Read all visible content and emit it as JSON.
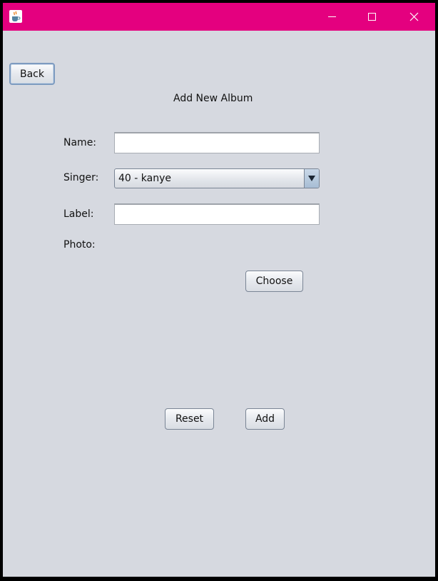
{
  "window": {
    "title": "",
    "titlebar_color": "#e4007f",
    "icons": {
      "app": "java-cup-icon",
      "minimize": "minimize-icon",
      "maximize": "maximize-icon",
      "close": "close-icon"
    }
  },
  "nav": {
    "back_label": "Back"
  },
  "form": {
    "heading": "Add New Album",
    "name_label": "Name:",
    "name_value": "",
    "singer_label": "Singer:",
    "singer_selected": "40 - kanye",
    "label_label": "Label:",
    "label_value": "",
    "photo_label": "Photo:",
    "choose_label": "Choose",
    "reset_label": "Reset",
    "add_label": "Add"
  }
}
